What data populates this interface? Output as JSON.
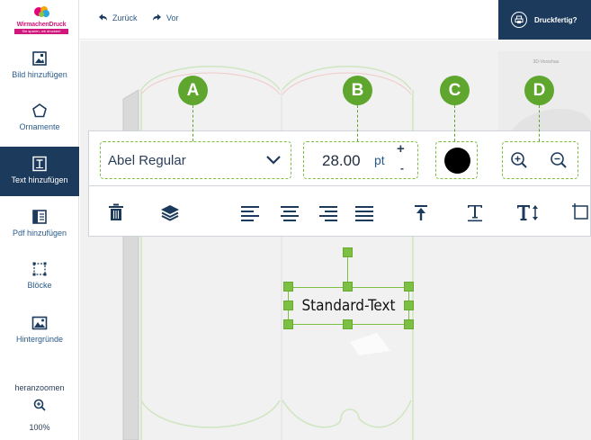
{
  "logo": {
    "name": "WirmachenDruck",
    "tagline": "Sie sparen, wir drucken!"
  },
  "sidebar": {
    "items": [
      {
        "label": "Bild hinzufügen",
        "icon": "image-add-icon"
      },
      {
        "label": "Ornamente",
        "icon": "pentagon-icon"
      },
      {
        "label": "Text hinzufügen",
        "icon": "text-add-icon"
      },
      {
        "label": "Pdf hinzufügen",
        "icon": "pdf-add-icon"
      },
      {
        "label": "Blöcke",
        "icon": "blocks-icon"
      },
      {
        "label": "Hintergründe",
        "icon": "background-icon"
      }
    ],
    "zoom_label": "heranzoomen",
    "zoom_value": "100%"
  },
  "topbar": {
    "back_label": "Zurück",
    "forward_label": "Vor",
    "print_label": "Druckfertig?"
  },
  "canvas": {
    "preview_label": "3D-Vorschau"
  },
  "text_toolbar": {
    "font": "Abel Regular",
    "size": "28.00",
    "unit": "pt",
    "plus": "+",
    "minus": "-",
    "color": "#000000"
  },
  "markers": [
    "A",
    "B",
    "C",
    "D"
  ],
  "text_element": {
    "content": "Standard-Text"
  },
  "colors": {
    "navy": "#1c3a5c",
    "accent_green": "#5ea62e",
    "handle_green": "#7cc043",
    "brand_pink": "#d0177e"
  }
}
